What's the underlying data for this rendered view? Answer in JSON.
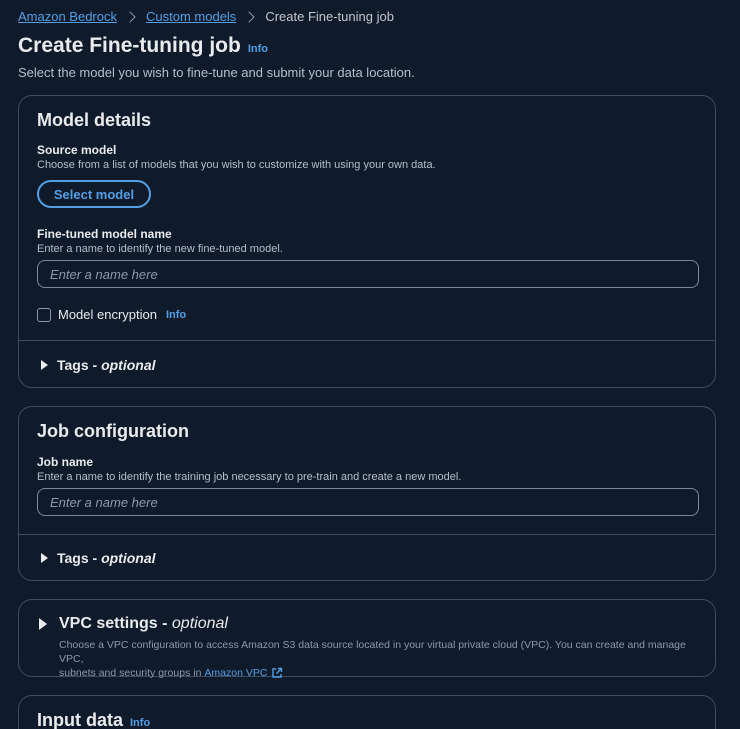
{
  "breadcrumb": {
    "items": [
      "Amazon Bedrock",
      "Custom models"
    ],
    "current": "Create Fine-tuning job"
  },
  "page": {
    "title": "Create Fine-tuning job",
    "info": "Info",
    "description": "Select the model you wish to fine-tune and submit your data location."
  },
  "model_details": {
    "header": "Model details",
    "source_label": "Source model",
    "source_desc": "Choose from a list of models that you wish to customize with using your own data.",
    "select_button": "Select model",
    "name_label": "Fine-tuned model name",
    "name_desc": "Enter a name to identify the new fine-tuned model.",
    "name_placeholder": "Enter a name here",
    "encryption_label": "Model encryption",
    "encryption_info": "Info",
    "tags_label": "Tags - ",
    "tags_optional": "optional"
  },
  "job_config": {
    "header": "Job configuration",
    "job_label": "Job name",
    "job_desc": "Enter a name to identify the training job necessary to pre-train and create a new model.",
    "job_placeholder": "Enter a name here",
    "tags_label": "Tags - ",
    "tags_optional": "optional"
  },
  "vpc": {
    "label": "VPC settings - ",
    "optional": "optional",
    "desc_line1": "Choose a VPC configuration to access Amazon S3 data source located in your virtual private cloud (VPC). You can create and manage VPC,",
    "desc_line2": "subnets and security groups in ",
    "link": "Amazon VPC"
  },
  "input_data": {
    "header": "Input data",
    "info": "Info"
  },
  "colors": {
    "background": "#0f1b2a",
    "link": "#539fe5",
    "border": "#414d5c"
  }
}
